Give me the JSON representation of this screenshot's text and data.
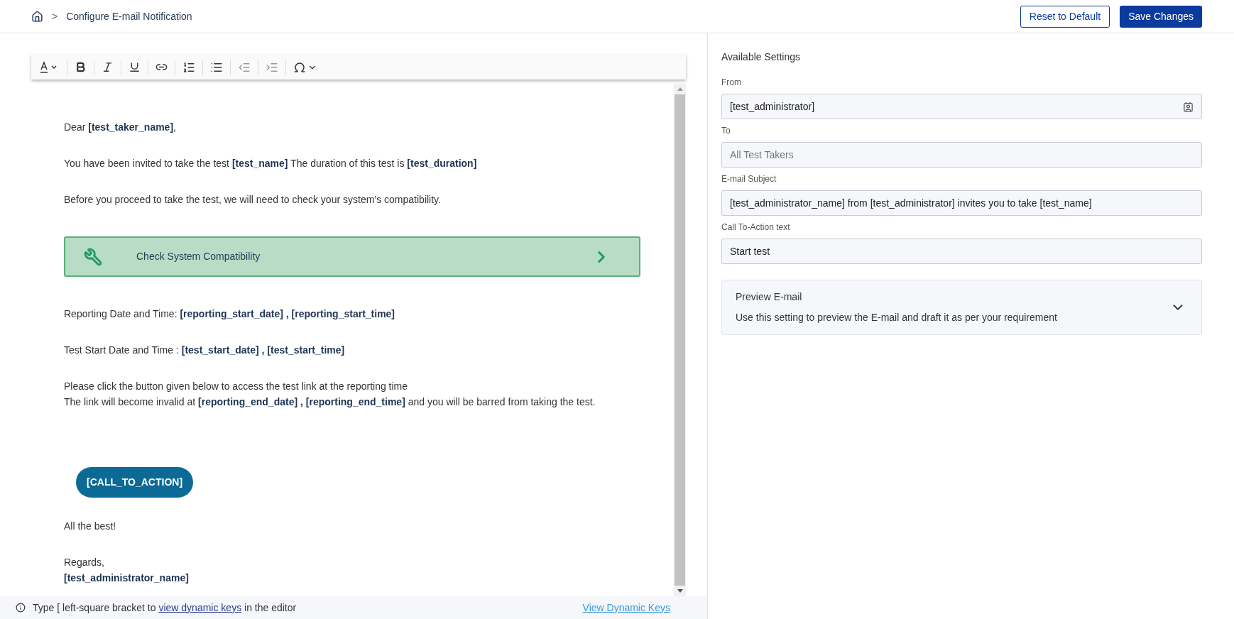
{
  "breadcrumb": {
    "title": "Configure E-mail Notification",
    "separator": ">"
  },
  "header_buttons": [
    {
      "label": "Reset to Default",
      "kind": "outline"
    },
    {
      "label": "Save Changes",
      "kind": "primary"
    }
  ],
  "email_body": [
    {
      "kind": "text",
      "lines": [
        "Dear **[test_taker_name]**,"
      ]
    },
    {
      "kind": "text",
      "lines": [
        "You have been invited to take the test **[test_name]** The duration of this test is **[test_duration]**"
      ]
    },
    {
      "kind": "text",
      "lines": [
        "Before you proceed to take the test, we will need to check your system’s compatibility."
      ]
    },
    {
      "kind": "check_button",
      "label": "Check System Compatibility"
    },
    {
      "kind": "text",
      "lines": [
        "Reporting Date and Time: **[reporting_start_date] , [reporting_start_time]**"
      ]
    },
    {
      "kind": "text",
      "lines": [
        "Test Start Date and Time : **[test_start_date] , [test_start_time]**"
      ]
    },
    {
      "kind": "text",
      "lines": [
        "Please click the button given below to access the test link at the reporting time",
        "The link will become invalid at **[reporting_end_date] , [reporting_end_time]** and you will be barred from taking the test."
      ]
    },
    {
      "kind": "cta_button",
      "label": "[CALL_TO_ACTION]"
    },
    {
      "kind": "text",
      "lines": [
        "All the best!"
      ]
    },
    {
      "kind": "text",
      "lines": [
        "Regards,",
        "**[test_administrator_name]**"
      ]
    }
  ],
  "footer": {
    "hint_before": "Type [ left-square bracket to",
    "hint_link": "view dynamic keys",
    "hint_after": "in the editor",
    "link": "View Dynamic Keys"
  },
  "settings": {
    "title": "Available Settings",
    "fields": [
      {
        "label": "From",
        "value": "[test_administrator]",
        "has_icon": true
      },
      {
        "label": "To",
        "placeholder": "All Test Takers",
        "has_icon": false
      },
      {
        "label": "E-mail Subject",
        "value": "[test_administrator_name] from [test_administrator] invites you to take [test_name]",
        "has_icon": false
      },
      {
        "label": "Call To-Action text",
        "value": "Start test",
        "has_icon": false
      }
    ],
    "preview": {
      "title": "Preview E-mail",
      "description": "Use this setting to preview the E-mail and draft it as per your requirement",
      "expanded": false
    }
  }
}
